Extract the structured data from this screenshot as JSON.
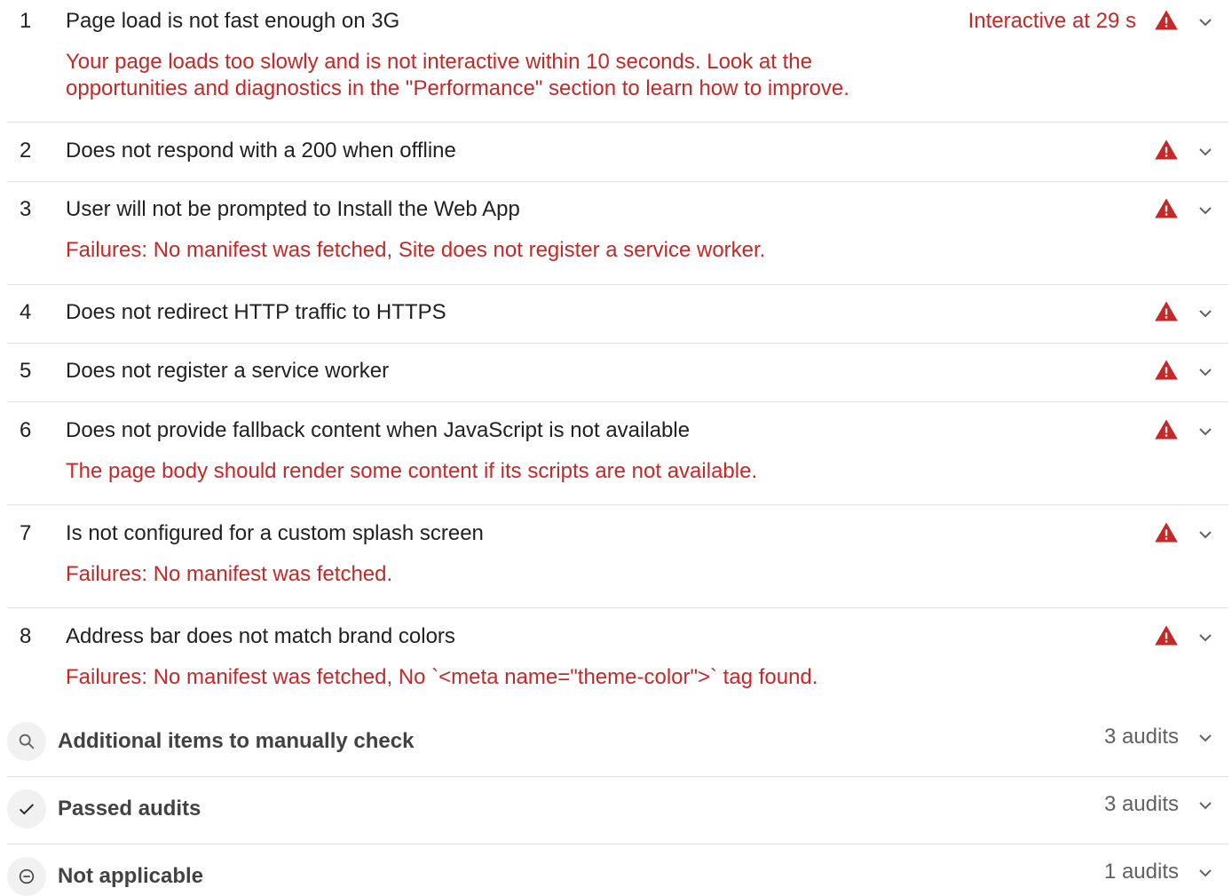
{
  "audits": [
    {
      "index": "1",
      "title": "Page load is not fast enough on 3G",
      "display_value": "Interactive at 29 s",
      "description": "Your page loads too slowly and is not interactive within 10 seconds. Look at the opportunities and diagnostics in the \"Performance\" section to learn how to improve."
    },
    {
      "index": "2",
      "title": "Does not respond with a 200 when offline"
    },
    {
      "index": "3",
      "title": "User will not be prompted to Install the Web App",
      "description": "Failures: No manifest was fetched, Site does not register a service worker."
    },
    {
      "index": "4",
      "title": "Does not redirect HTTP traffic to HTTPS"
    },
    {
      "index": "5",
      "title": "Does not register a service worker"
    },
    {
      "index": "6",
      "title": "Does not provide fallback content when JavaScript is not available",
      "description": "The page body should render some content if its scripts are not available."
    },
    {
      "index": "7",
      "title": "Is not configured for a custom splash screen",
      "description": "Failures: No manifest was fetched."
    },
    {
      "index": "8",
      "title": "Address bar does not match brand colors",
      "description": "Failures: No manifest was fetched, No `<meta name=\"theme-color\">` tag found."
    }
  ],
  "groups": [
    {
      "title": "Additional items to manually check",
      "count": "3 audits",
      "icon": "search-icon"
    },
    {
      "title": "Passed audits",
      "count": "3 audits",
      "icon": "checkmark-icon"
    },
    {
      "title": "Not applicable",
      "count": "1 audits",
      "icon": "minus-circle-icon"
    }
  ],
  "colors": {
    "fail": "#c62828",
    "text": "#212121",
    "divider": "#e0e0e0",
    "group_icon_bg": "#f1f1f1"
  }
}
